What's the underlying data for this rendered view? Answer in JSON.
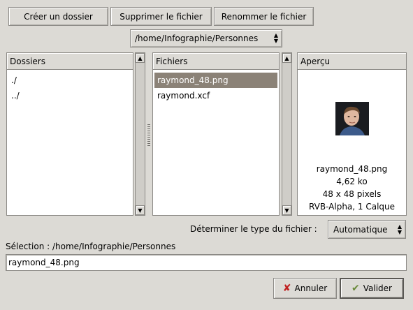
{
  "toolbar": {
    "create_folder": "Créer un dossier",
    "delete_file": "Supprimer le fichier",
    "rename_file": "Renommer le fichier"
  },
  "path_selector": {
    "value": "/home/Infographie/Personnes"
  },
  "folders": {
    "header": "Dossiers",
    "items": [
      "./",
      "../"
    ]
  },
  "files": {
    "header": "Fichiers",
    "items": [
      "raymond_48.png",
      "raymond.xcf"
    ],
    "selected_index": 0
  },
  "preview": {
    "header": "Aperçu",
    "file_name": "raymond_48.png",
    "size": "4,62 ko",
    "dimensions": "48 x 48 pixels",
    "info": "RVB-Alpha, 1 Calque"
  },
  "file_type": {
    "label": "Déterminer le type du fichier :",
    "value": "Automatique"
  },
  "selection": {
    "label": "Sélection : /home/Infographie/Personnes",
    "value": "raymond_48.png"
  },
  "actions": {
    "cancel": "Annuler",
    "ok": "Valider"
  },
  "colors": {
    "background": "#dcdad5",
    "selection": "#8b8277",
    "cancel_icon": "#c02020",
    "ok_icon": "#6a8a3a"
  }
}
